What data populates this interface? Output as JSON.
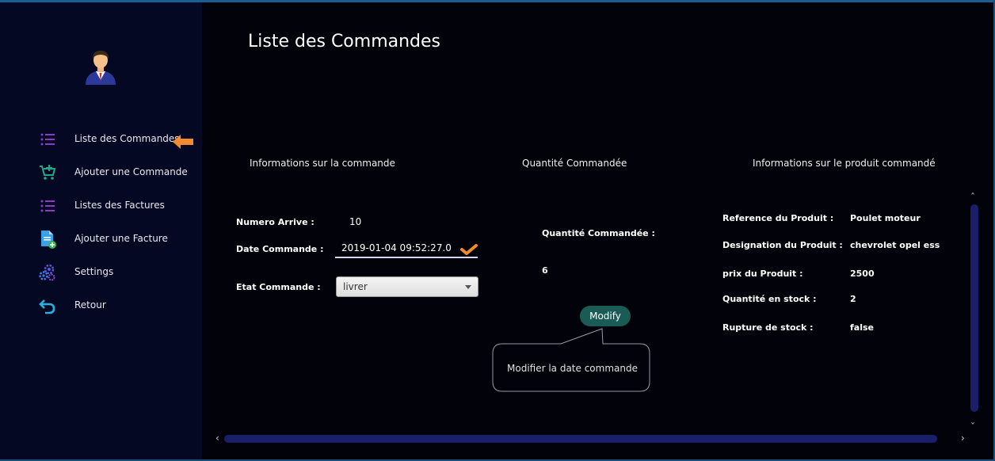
{
  "sidebar": {
    "items": [
      {
        "label": "Liste des Commandes",
        "icon": "list-icon"
      },
      {
        "label": "Ajouter une Commande",
        "icon": "cart-add-icon"
      },
      {
        "label": "Listes des Factures",
        "icon": "list-icon"
      },
      {
        "label": "Ajouter une Facture",
        "icon": "document-add-icon"
      },
      {
        "label": "Settings",
        "icon": "gears-icon"
      },
      {
        "label": "Retour",
        "icon": "undo-icon"
      }
    ],
    "active_indicator_color": "#f28a30"
  },
  "main": {
    "title": "Liste des Commandes",
    "sections": {
      "commande": "Informations sur la commande",
      "quantite": "Quantité Commandée",
      "produit": "Informations sur le produit commandé"
    },
    "commande": {
      "numero_label": "Numero Arrive :",
      "numero_value": "10",
      "date_label": "Date Commande :",
      "date_value": "2019-01-04 09:52:27.0",
      "etat_label": "Etat Commande :",
      "etat_value": "livrer"
    },
    "quantite": {
      "label": "Quantité Commandée :",
      "value": "6"
    },
    "modify_button": "Modify",
    "tooltip": "Modifier la date  commande",
    "produit": {
      "reference_label": "Reference du Produit :",
      "reference_value": "Poulet moteur",
      "designation_label": "Designation du Produit :",
      "designation_value": "chevrolet opel ess",
      "prix_label": "prix du Produit :",
      "prix_value": "2500",
      "stock_label": "Quantité en stock :",
      "stock_value": "2",
      "rupture_label": "Rupture de stock :",
      "rupture_value": "false"
    }
  },
  "colors": {
    "background": "#02030a",
    "sidebar": "#050822",
    "accent_orange": "#f28a30",
    "button_teal": "#1a5c55",
    "scrollbar": "#1a1f6a"
  }
}
